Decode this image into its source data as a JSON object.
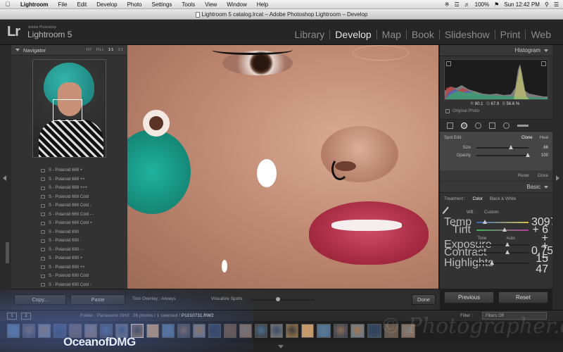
{
  "menubar": {
    "items": [
      "Lightroom",
      "File",
      "Edit",
      "Develop",
      "Photo",
      "Settings",
      "Tools",
      "View",
      "Window",
      "Help"
    ],
    "status": {
      "zoom": "100%",
      "clock": "Sun 12:42 PM"
    }
  },
  "window": {
    "title": "Lightroom 5 catalog.lrcat – Adobe Photoshop Lightroom – Develop"
  },
  "identity": {
    "logo": "Lr",
    "brand": "Adobe Photoshop",
    "product": "Lightroom 5"
  },
  "modules": [
    "Library",
    "Develop",
    "Map",
    "Book",
    "Slideshow",
    "Print",
    "Web"
  ],
  "navigator": {
    "title": "Navigator",
    "zooms": [
      "FIT",
      "FILL",
      "1:1",
      "3:1"
    ]
  },
  "presets": [
    "S - Polaroid 669 +",
    "S - Polaroid 669 ++",
    "S - Polaroid 669 +++",
    "S - Polaroid 669 Cold",
    "S - Polaroid 669 Cold -",
    "S - Polaroid 669 Cold - -",
    "S - Polaroid 669 Cold +",
    "S - Polaroid 690",
    "S - Polaroid 690 -",
    "S - Polaroid 690 - -",
    "S - Polaroid 690 +",
    "S - Polaroid 690 ++",
    "S - Polaroid 690 Cold",
    "S - Polaroid 690 Cold -"
  ],
  "histogram": {
    "title": "Histogram",
    "readout": {
      "r_label": "R",
      "r": "80.1",
      "g_label": "G",
      "g": "67.9",
      "b_label": "B",
      "b": "56.6 %"
    },
    "original_photo": "Original Photo"
  },
  "spot_edit": {
    "label": "Spot Edit :",
    "modes": [
      "Clone",
      "Heal"
    ],
    "size_label": "Size",
    "size": ".66",
    "opacity_label": "Opacity",
    "opacity": "100",
    "reset": "Reset",
    "close": "Close"
  },
  "basic": {
    "title": "Basic",
    "treatment_label": "Treatment :",
    "treatments": [
      "Color",
      "Black & White"
    ],
    "wb_label": "WB :",
    "wb_value": "Custom",
    "temp_label": "Temp",
    "temp": "3097",
    "tint_label": "Tint",
    "tint": "+ 6",
    "tone_label": "Tone",
    "tone_auto": "Auto",
    "exposure_label": "Exposure",
    "exposure": "+ 0.75",
    "contrast_label": "Contrast",
    "contrast": "+ 15",
    "highlights_label": "Highlights",
    "highlights": "– 47"
  },
  "panel_buttons": {
    "previous": "Previous",
    "reset": "Reset"
  },
  "toolbar": {
    "copy": "Copy...",
    "paste": "Paste",
    "tool_overlay": "Tool Overlay : Always",
    "visualize_spots": "Visualize Spots",
    "done": "Done"
  },
  "filmstrip": {
    "pages": [
      "1",
      "2"
    ],
    "breadcrumb": "Folder : Panasonic GH3",
    "counts": "26 photos / 1 selected /",
    "selected_file": "P1010731.RW2",
    "filter_label": "Filter :",
    "filter_value": "Filters Off",
    "thumb_count": 26
  },
  "watermarks": {
    "left": "OceanofDMG",
    "right": "© Photographer.com"
  },
  "colors": {
    "accent": "#e6e6e6",
    "panel": "#323232",
    "background": "#1e1e1e"
  }
}
